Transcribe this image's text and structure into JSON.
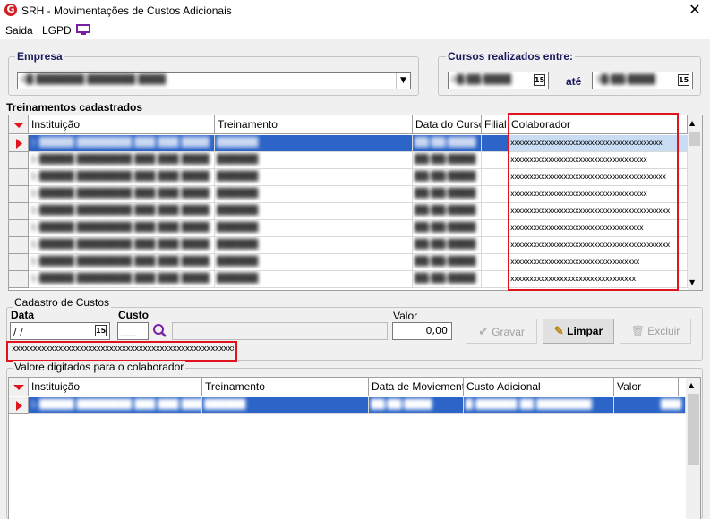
{
  "window": {
    "title": "SRH - Movimentações de Custos Adicionais",
    "close_glyph": "✕"
  },
  "menu": {
    "items": [
      "Saida",
      "LGPD"
    ]
  },
  "empresa": {
    "label": "Empresa",
    "value": "0█ ███████ ███████ ████"
  },
  "cursos": {
    "label": "Cursos realizados entre:",
    "start": "0█/██/████",
    "ate": "até",
    "end": "3█/██/████"
  },
  "treinamentos": {
    "label": "Treinamentos cadastrados",
    "columns": [
      "Instituição",
      "Treinamento",
      "Data do Curso",
      "Filial",
      "Colaborador"
    ],
    "rows": [
      {
        "instituicao": "1-█████ ████████ ███ ███ ████",
        "treinamento": "██████",
        "data": "██/██/████",
        "filial": "",
        "colaborador": "xxxxxxxxxxxxxxxxxxxxxxxxxxxxxxxxxxxxxxxx"
      },
      {
        "instituicao": "1-█████ ████████ ███ ███ ████",
        "treinamento": "██████",
        "data": "██/██/████",
        "filial": "",
        "colaborador": "xxxxxxxxxxxxxxxxxxxxxxxxxxxxxxxxxxxx"
      },
      {
        "instituicao": "1-█████ ████████ ███ ███ ████",
        "treinamento": "██████",
        "data": "██/██/████",
        "filial": "",
        "colaborador": "xxxxxxxxxxxxxxxxxxxxxxxxxxxxxxxxxxxxxxxxx"
      },
      {
        "instituicao": "1-█████ ████████ ███ ███ ████",
        "treinamento": "██████",
        "data": "██/██/████",
        "filial": "",
        "colaborador": "xxxxxxxxxxxxxxxxxxxxxxxxxxxxxxxxxxxx"
      },
      {
        "instituicao": "1-█████ ████████ ███ ███ ████",
        "treinamento": "██████",
        "data": "██/██/████",
        "filial": "",
        "colaborador": "xxxxxxxxxxxxxxxxxxxxxxxxxxxxxxxxxxxxxxxxxx"
      },
      {
        "instituicao": "1-█████ ████████ ███ ███ ████",
        "treinamento": "██████",
        "data": "██/██/████",
        "filial": "",
        "colaborador": "xxxxxxxxxxxxxxxxxxxxxxxxxxxxxxxxxxx"
      },
      {
        "instituicao": "1-█████ ████████ ███ ███ ████",
        "treinamento": "██████",
        "data": "██/██/████",
        "filial": "",
        "colaborador": "xxxxxxxxxxxxxxxxxxxxxxxxxxxxxxxxxxxxxxxxxx"
      },
      {
        "instituicao": "1-█████ ████████ ███ ███ ████",
        "treinamento": "██████",
        "data": "██/██/████",
        "filial": "",
        "colaborador": "xxxxxxxxxxxxxxxxxxxxxxxxxxxxxxxxxx"
      },
      {
        "instituicao": "1-█████ ████████ ███ ███ ████",
        "treinamento": "██████",
        "data": "██/██/████",
        "filial": "",
        "colaborador": "xxxxxxxxxxxxxxxxxxxxxxxxxxxxxxxxx"
      }
    ]
  },
  "cadastro": {
    "label": "Cadastro de Custos",
    "data_label": "Data",
    "data_value": " / /",
    "custo_label": "Custo",
    "custo_value": "___",
    "valor_label": "Valor",
    "valor_value": "0,00",
    "gravar": "Gravar",
    "limpar": "Limpar",
    "excluir": "Excluir",
    "collab_text": "xxxxxxxxxxxxxxxxxxxxxxxxxxxxxxxxxxxxxxxxxxxxxxxxxxxxxxxxxxxxxxxx"
  },
  "valores": {
    "label": "Valore digitados para o colaborador",
    "columns": [
      "Instituição",
      "Treinamento",
      "Data de Moviemento",
      "Custo Adicional",
      "Valor"
    ],
    "rows": [
      {
        "instituicao": "1-█████ ████████ ███ ███ ████",
        "treinamento": "██████",
        "data": "██/██/████",
        "custo": "█-██████ ██ ████████",
        "valor": "███"
      }
    ]
  },
  "colors": {
    "selection": "#2c64c8",
    "highlight_box": "#e0141e",
    "accent": "#7a1fa2"
  }
}
